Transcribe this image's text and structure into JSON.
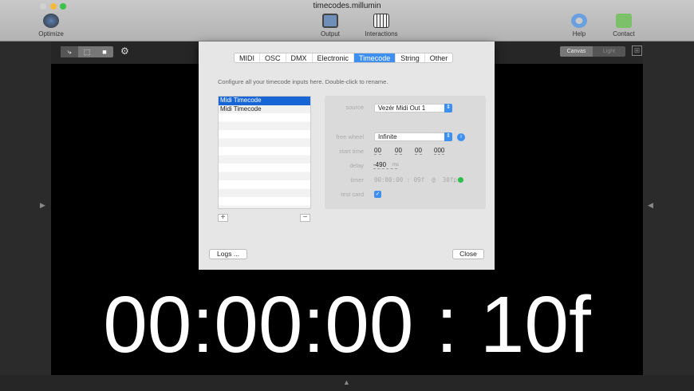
{
  "window": {
    "title": "timecodes.millumin"
  },
  "toolbar": {
    "optimize": "Optimize",
    "output": "Output",
    "interactions": "Interactions",
    "help": "Help",
    "contact": "Contact"
  },
  "view": {
    "canvas": "Canvas",
    "light": "Light"
  },
  "dialog": {
    "tabs": [
      "MIDI",
      "OSC",
      "DMX",
      "Electronic",
      "Timecode",
      "String",
      "Other"
    ],
    "active_tab": "Timecode",
    "description": "Configure all your timecode inputs here. Double-click to rename.",
    "inputs": [
      "Midi Timecode",
      "Midi Timecode"
    ],
    "add": "+",
    "remove": "−",
    "source_label": "source",
    "source_value": "Vezér Midi Out 1",
    "freewheel_label": "free wheel",
    "freewheel_value": "Infinite",
    "starttime_label": "start time",
    "start": [
      "00",
      "00",
      "00",
      "000"
    ],
    "delay_label": "delay",
    "delay_value": "-490",
    "delay_unit": "ms",
    "timer_label": "timer",
    "timer_value": "00:00:00 : 09f  @  30fps",
    "testcard_label": "test card",
    "testcard_checked": true,
    "logs": "Logs ...",
    "close": "Close"
  },
  "canvas": {
    "timecode": "00:00:00 : 10f"
  }
}
